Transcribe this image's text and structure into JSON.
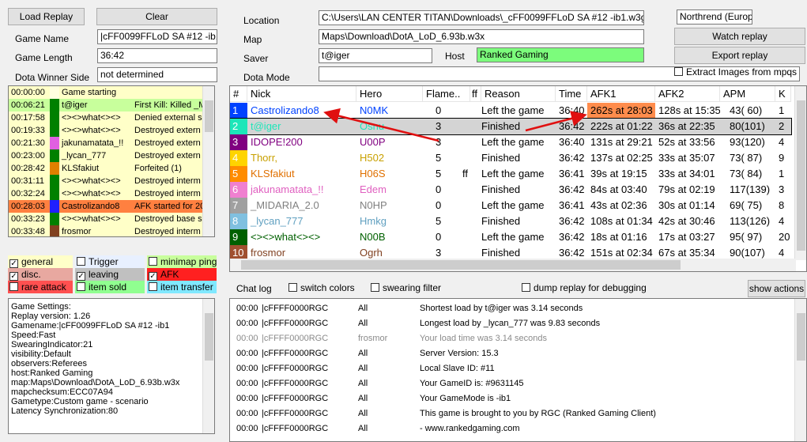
{
  "top": {
    "load_replay": "Load Replay",
    "clear": "Clear",
    "watch_replay": "Watch replay",
    "export_replay": "Export replay",
    "extract_images": "Extract Images from mpqs",
    "region": "Northrend (Europe)"
  },
  "game": {
    "name_label": "Game Name",
    "name": "|cFF0099FFLoD SA #12 -ib1",
    "length_label": "Game Length",
    "length": "36:42",
    "winner_label": "Dota Winner Side",
    "winner": "not determined",
    "location_label": "Location",
    "location": "C:\\Users\\LAN CENTER TITAN\\Downloads\\_cFF0099FFLoD SA #12 -ib1.w3g",
    "map_label": "Map",
    "map": "Maps\\Download\\DotA_LoD_6.93b.w3x",
    "saver_label": "Saver",
    "saver": "t@iger",
    "host_label": "Host",
    "host": "Ranked Gaming",
    "mode_label": "Dota Mode",
    "mode": ""
  },
  "events": [
    {
      "time": "00:00:00",
      "color": "#ffffe0",
      "name": "Game starting",
      "text": "",
      "bg": "#ffffc8"
    },
    {
      "time": "00:06:21",
      "color": "#008000",
      "name": "t@iger",
      "text": "First Kill: Killed _M",
      "bg": "#c8ff9c"
    },
    {
      "time": "00:17:58",
      "color": "#008000",
      "name": "<><>what<><>",
      "text": "Denied external s",
      "bg": "#ffffc8"
    },
    {
      "time": "00:19:33",
      "color": "#008000",
      "name": "<><>what<><>",
      "text": "Destroyed extern",
      "bg": "#ffffc8"
    },
    {
      "time": "00:21:30",
      "color": "#e060e0",
      "name": "jakunamatata_!!",
      "text": "Destroyed extern",
      "bg": "#ffffc8"
    },
    {
      "time": "00:23:00",
      "color": "#008000",
      "name": "_lycan_777",
      "text": "Destroyed extern",
      "bg": "#ffffc8"
    },
    {
      "time": "00:28:42",
      "color": "#e08000",
      "name": "KLSfakiut",
      "text": "Forfeited (1)",
      "bg": "#ffffc8"
    },
    {
      "time": "00:31:11",
      "color": "#008000",
      "name": "<><>what<><>",
      "text": "Destroyed interm",
      "bg": "#ffffc8"
    },
    {
      "time": "00:32:24",
      "color": "#008000",
      "name": "<><>what<><>",
      "text": "Destroyed interm",
      "bg": "#ffffc8"
    },
    {
      "time": "00:28:03",
      "color": "#2020ff",
      "name": "Castrolizando8",
      "text": "AFK started for 20",
      "bg": "#ff8040"
    },
    {
      "time": "00:33:23",
      "color": "#008000",
      "name": "<><>what<><>",
      "text": "Destroyed base s",
      "bg": "#ffffc8"
    },
    {
      "time": "00:33:48",
      "color": "#804020",
      "name": "frosmor",
      "text": "Destroyed interm",
      "bg": "#ffffc8"
    }
  ],
  "filters": [
    {
      "label": "general",
      "checked": true,
      "bg": "#ffffc8"
    },
    {
      "label": "Trigger",
      "checked": false,
      "bg": "#e8f0ff"
    },
    {
      "label": "minimap ping",
      "checked": false,
      "bg": "#c8ff9c"
    },
    {
      "label": "disc.",
      "checked": true,
      "bg": "#e8a8a0"
    },
    {
      "label": "leaving",
      "checked": true,
      "bg": "#c0c0c0"
    },
    {
      "label": "AFK",
      "checked": true,
      "bg": "#ff2020"
    },
    {
      "label": "rare attack",
      "checked": false,
      "bg": "#ff5050"
    },
    {
      "label": "item sold",
      "checked": false,
      "bg": "#90ff90"
    },
    {
      "label": "item transfer",
      "checked": false,
      "bg": "#80e8ff"
    }
  ],
  "settings": [
    "Game Settings:",
    "Replay version: 1.26",
    "Gamename:|cFF0099FFLoD SA #12 -ib1",
    "Speed:Fast",
    "SwearingIndicator:21",
    "visibility:Default",
    "observers:Referees",
    "host:Ranked Gaming",
    "map:Maps\\Download\\DotA_LoD_6.93b.w3x",
    "mapchecksum:ECC07A94",
    "Gametype:Custom game - scenario",
    "Latency Synchronization:80"
  ],
  "players_header": [
    "#",
    "Nick",
    "Hero",
    "Flame..",
    "ff",
    "Reason",
    "Time",
    "AFK1",
    "AFK2",
    "APM",
    "K"
  ],
  "players": [
    {
      "n": "1",
      "slot": "#0042ff",
      "nick": "Castrolizando8",
      "nickColor": "#0042ff",
      "hero": "N0MK",
      "flame": "0",
      "ff": "",
      "reason": "Left the game",
      "time": "36:40",
      "afk1": "262s at 28:03",
      "afk2": "128s at 15:35",
      "apm": "43( 60)",
      "k": "1",
      "afk1bg": "#ff8c4c"
    },
    {
      "n": "2",
      "slot": "#1ce6b9",
      "nick": "t@iger",
      "nickColor": "#1ce6b9",
      "hero": "Osnu",
      "flame": "3",
      "ff": "",
      "reason": "Finished",
      "time": "36:42",
      "afk1": "222s at 01:22",
      "afk2": "36s at 22:35",
      "apm": "80(101)",
      "k": "2",
      "afk1bg": ""
    },
    {
      "n": "3",
      "slot": "#800080",
      "nick": "IDOPE!200",
      "nickColor": "#800080",
      "hero": "U00P",
      "flame": "3",
      "ff": "",
      "reason": "Left the game",
      "time": "36:40",
      "afk1": "131s at 29:21",
      "afk2": "52s at 33:56",
      "apm": "93(120)",
      "k": "4",
      "afk1bg": ""
    },
    {
      "n": "4",
      "slot": "#ffd400",
      "nick": "Thorr,",
      "nickColor": "#c8a000",
      "hero": "H502",
      "flame": "5",
      "ff": "",
      "reason": "Finished",
      "time": "36:42",
      "afk1": "137s at 02:25",
      "afk2": "33s at 35:07",
      "apm": "73( 87)",
      "k": "9",
      "afk1bg": ""
    },
    {
      "n": "5",
      "slot": "#ff8c00",
      "nick": "KLSfakiut",
      "nickColor": "#e07000",
      "hero": "H06S",
      "flame": "5",
      "ff": "ff",
      "reason": "Left the game",
      "time": "36:41",
      "afk1": "39s at 19:15",
      "afk2": "33s at 34:01",
      "apm": "73( 84)",
      "k": "1",
      "afk1bg": ""
    },
    {
      "n": "6",
      "slot": "#f080d0",
      "nick": "jakunamatata_!!",
      "nickColor": "#e060c0",
      "hero": "Edem",
      "flame": "0",
      "ff": "",
      "reason": "Finished",
      "time": "36:42",
      "afk1": "84s at 03:40",
      "afk2": "79s at 02:19",
      "apm": "117(139)",
      "k": "3",
      "afk1bg": ""
    },
    {
      "n": "7",
      "slot": "#a0a0a0",
      "nick": "_MIDARIA_2.0",
      "nickColor": "#808080",
      "hero": "N0HP",
      "flame": "0",
      "ff": "",
      "reason": "Left the game",
      "time": "36:41",
      "afk1": "43s at 02:36",
      "afk2": "30s at 01:14",
      "apm": "69( 75)",
      "k": "8",
      "afk1bg": ""
    },
    {
      "n": "8",
      "slot": "#80c0e0",
      "nick": "_lycan_777",
      "nickColor": "#60a0c0",
      "hero": "Hmkg",
      "flame": "5",
      "ff": "",
      "reason": "Finished",
      "time": "36:42",
      "afk1": "108s at 01:34",
      "afk2": "42s at 30:46",
      "apm": "113(126)",
      "k": "4",
      "afk1bg": ""
    },
    {
      "n": "9",
      "slot": "#006000",
      "nick": "<><>what<><>",
      "nickColor": "#006000",
      "hero": "N00B",
      "flame": "0",
      "ff": "",
      "reason": "Left the game",
      "time": "36:42",
      "afk1": "18s at 01:16",
      "afk2": "17s at 03:27",
      "apm": "95( 97)",
      "k": "20",
      "afk1bg": ""
    },
    {
      "n": "10",
      "slot": "#a05030",
      "nick": "frosmor",
      "nickColor": "#804020",
      "hero": "Ogrh",
      "flame": "3",
      "ff": "",
      "reason": "Finished",
      "time": "36:42",
      "afk1": "151s at 02:34",
      "afk2": "67s at 35:34",
      "apm": "90(107)",
      "k": "4",
      "afk1bg": ""
    }
  ],
  "chat_controls": {
    "label": "Chat log",
    "switch_colors": "switch colors",
    "swearing_filter": "swearing filter",
    "dump_replay": "dump replay for debugging",
    "show_actions": "show actions"
  },
  "chat": [
    {
      "time": "00:00",
      "from": "|cFFFF0000RGC",
      "to": "All",
      "msg": "Shortest load by t@iger was 3.14 seconds",
      "gray": false
    },
    {
      "time": "00:00",
      "from": "|cFFFF0000RGC",
      "to": "All",
      "msg": "Longest load by _lycan_777 was 9.83 seconds",
      "gray": false
    },
    {
      "time": "00:00",
      "from": "|cFFFF0000RGC",
      "to": "frosmor",
      "msg": "Your load time was 3.14 seconds",
      "gray": true
    },
    {
      "time": "00:00",
      "from": "|cFFFF0000RGC",
      "to": "All",
      "msg": "Server Version: 15.3",
      "gray": false
    },
    {
      "time": "00:00",
      "from": "|cFFFF0000RGC",
      "to": "All",
      "msg": "Local Slave ID: #11",
      "gray": false
    },
    {
      "time": "00:00",
      "from": "|cFFFF0000RGC",
      "to": "All",
      "msg": "Your GameID is: #9631145",
      "gray": false
    },
    {
      "time": "00:00",
      "from": "|cFFFF0000RGC",
      "to": "All",
      "msg": "Your GameMode is -ib1",
      "gray": false
    },
    {
      "time": "00:00",
      "from": "|cFFFF0000RGC",
      "to": "All",
      "msg": "This game is brought to you by RGC (Ranked Gaming Client)",
      "gray": false
    },
    {
      "time": "00:00",
      "from": "|cFFFF0000RGC",
      "to": "All",
      "msg": "- www.rankedgaming.com",
      "gray": false
    }
  ],
  "colors": {
    "host_bg": "#7cfc7c",
    "arrow": "#e01010",
    "selected_row": "#d4d4d4"
  }
}
